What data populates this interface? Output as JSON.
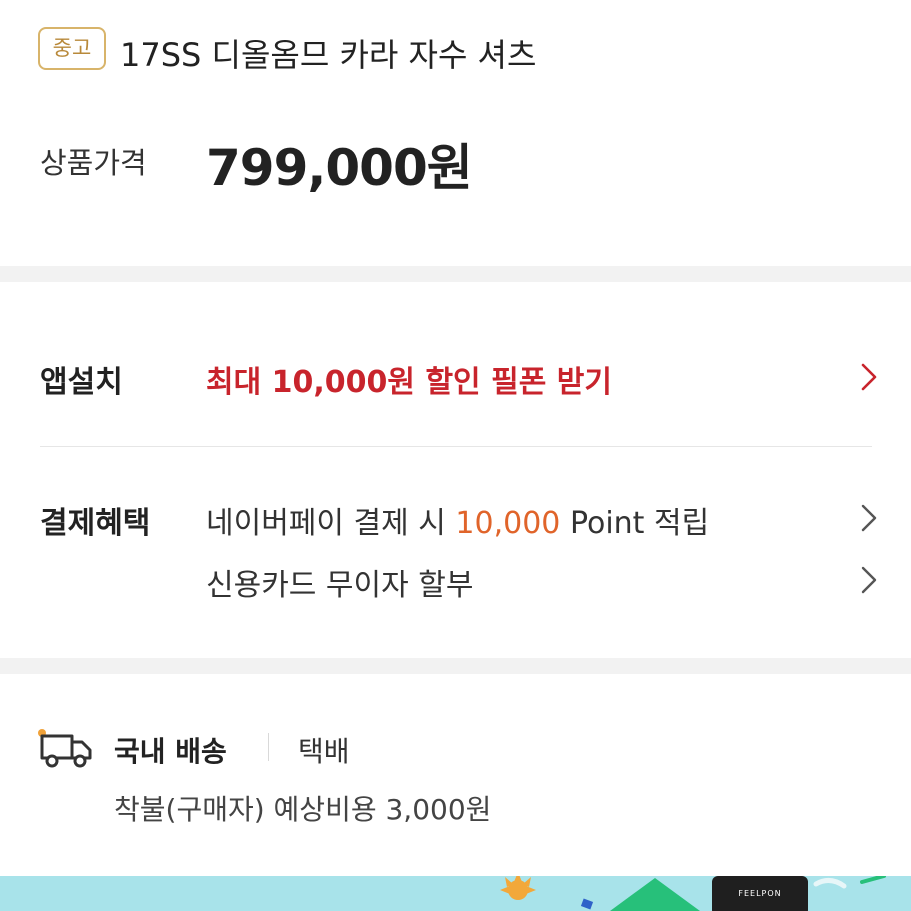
{
  "product": {
    "condition_badge": "중고",
    "title": "17SS 디올옴므 카라 자수 셔츠"
  },
  "price": {
    "label": "상품가격",
    "value": "799,000원"
  },
  "app_install": {
    "label": "앱설치",
    "promo": "최대 10,000원 할인 필폰 받기"
  },
  "payment": {
    "label": "결제혜택",
    "benefit1_prefix": "네이버페이 결제 시 ",
    "benefit1_highlight": "10,000",
    "benefit1_suffix": " Point 적립",
    "benefit2": "신용카드 무이자 할부"
  },
  "shipping": {
    "label": "국내 배송",
    "method": "택배",
    "fee": "착불(구매자) 예상비용 3,000원"
  },
  "banner": {
    "brand": "FEELPON"
  },
  "colors": {
    "promo_red": "#c8242c",
    "highlight_orange": "#e0642a",
    "badge_gold": "#d8b46a",
    "banner_bg": "#a8e3ea"
  }
}
